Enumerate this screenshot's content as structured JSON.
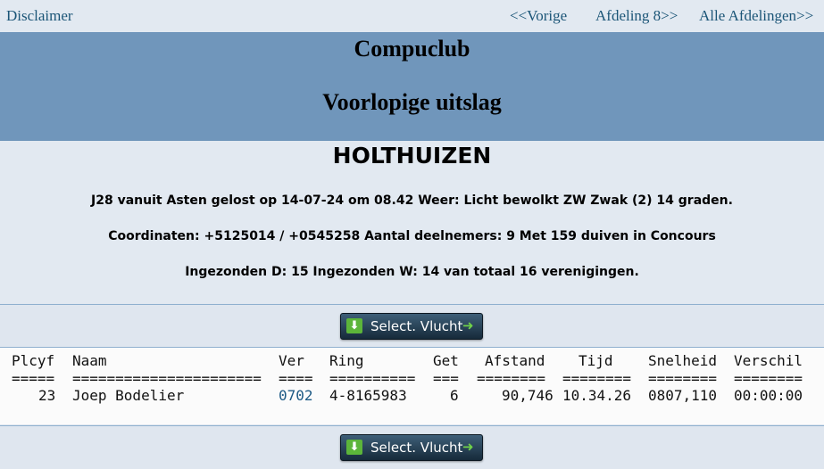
{
  "nav": {
    "disclaimer": "Disclaimer",
    "prev": "<<Vorige",
    "next": "Afdeling 8>>",
    "all": "Alle Afdelingen>>"
  },
  "banner": {
    "club": "Compuclub",
    "subtitle": "Voorlopige uitslag"
  },
  "race": {
    "venue": "HOLTHUIZEN",
    "line1": "J28 vanuit Asten gelost op 14-07-24 om 08.42 Weer: Licht bewolkt ZW Zwak (2) 14 graden.",
    "line2": "Coordinaten: +5125014 / +0545258 Aantal deelnemers: 9 Met 159 duiven in Concours",
    "line3": "Ingezonden D: 15 Ingezonden W: 14 van totaal 16 verenigingen."
  },
  "select_button": "Select. Vlucht",
  "table": {
    "headers": {
      "plcyf": "Plcyf",
      "naam": "Naam",
      "ver": "Ver",
      "ring": "Ring",
      "get": "Get",
      "afstand": "Afstand",
      "tijd": "Tijd",
      "snelheid": "Snelheid",
      "verschil": "Verschil"
    },
    "dividers": {
      "plcyf": "=====",
      "naam": "======================",
      "ver": "====",
      "ring": "==========",
      "get": "===",
      "afstand": "========",
      "tijd": "========",
      "snelheid": "========",
      "verschil": "========"
    },
    "rows": [
      {
        "plcyf": "23",
        "naam": "Joep Bodelier",
        "ver": "0702",
        "ring": "4-8165983",
        "get": "6",
        "afstand": "90,746",
        "tijd": "10.34.26",
        "snelheid": "0807,110",
        "verschil": "00:00:00"
      }
    ]
  }
}
